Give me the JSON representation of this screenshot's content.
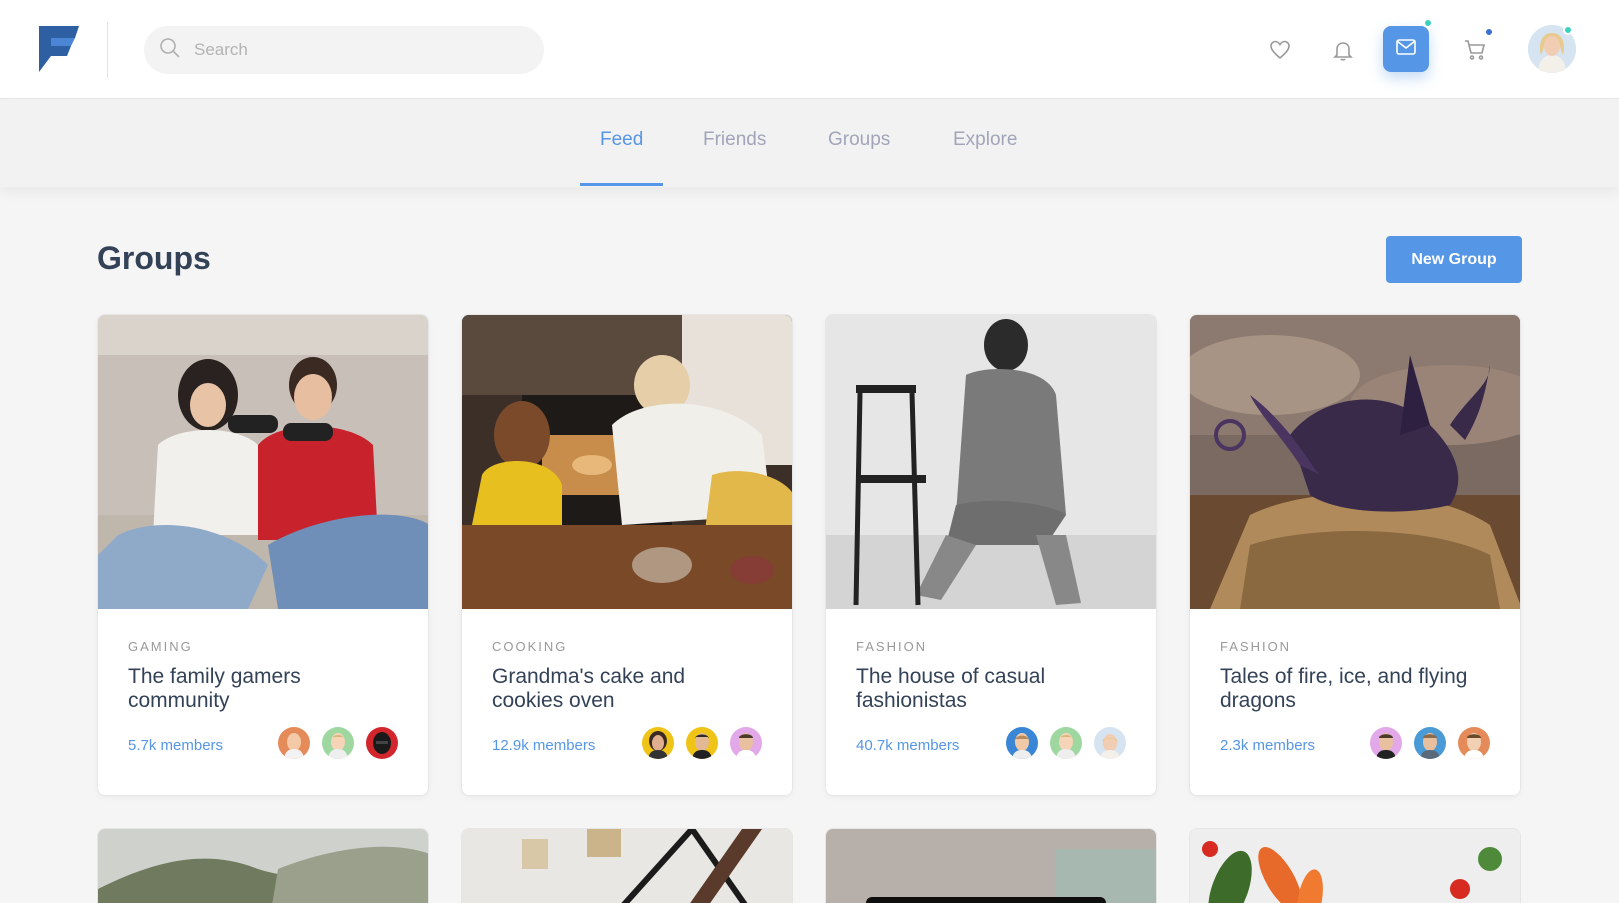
{
  "header": {
    "logo_icon": "app-logo-icon",
    "search_placeholder": "Search",
    "icons": [
      "heart-icon",
      "bell-icon",
      "mail-icon",
      "cart-icon"
    ],
    "accent": "#5596e6"
  },
  "tabs": [
    {
      "label": "Feed",
      "active": true
    },
    {
      "label": "Friends",
      "active": false
    },
    {
      "label": "Groups",
      "active": false
    },
    {
      "label": "Explore",
      "active": false
    }
  ],
  "page": {
    "title": "Groups",
    "new_group_label": "New Group"
  },
  "groups": [
    {
      "category": "GAMING",
      "title": "The family gamers community",
      "members": "5.7k members"
    },
    {
      "category": "COOKING",
      "title": "Grandma's cake and cookies oven",
      "members": "12.9k members"
    },
    {
      "category": "FASHION",
      "title": "The house of casual fashionistas",
      "members": "40.7k members"
    },
    {
      "category": "FASHION",
      "title": "Tales of fire, ice, and flying dragons",
      "members": "2.3k members"
    }
  ]
}
